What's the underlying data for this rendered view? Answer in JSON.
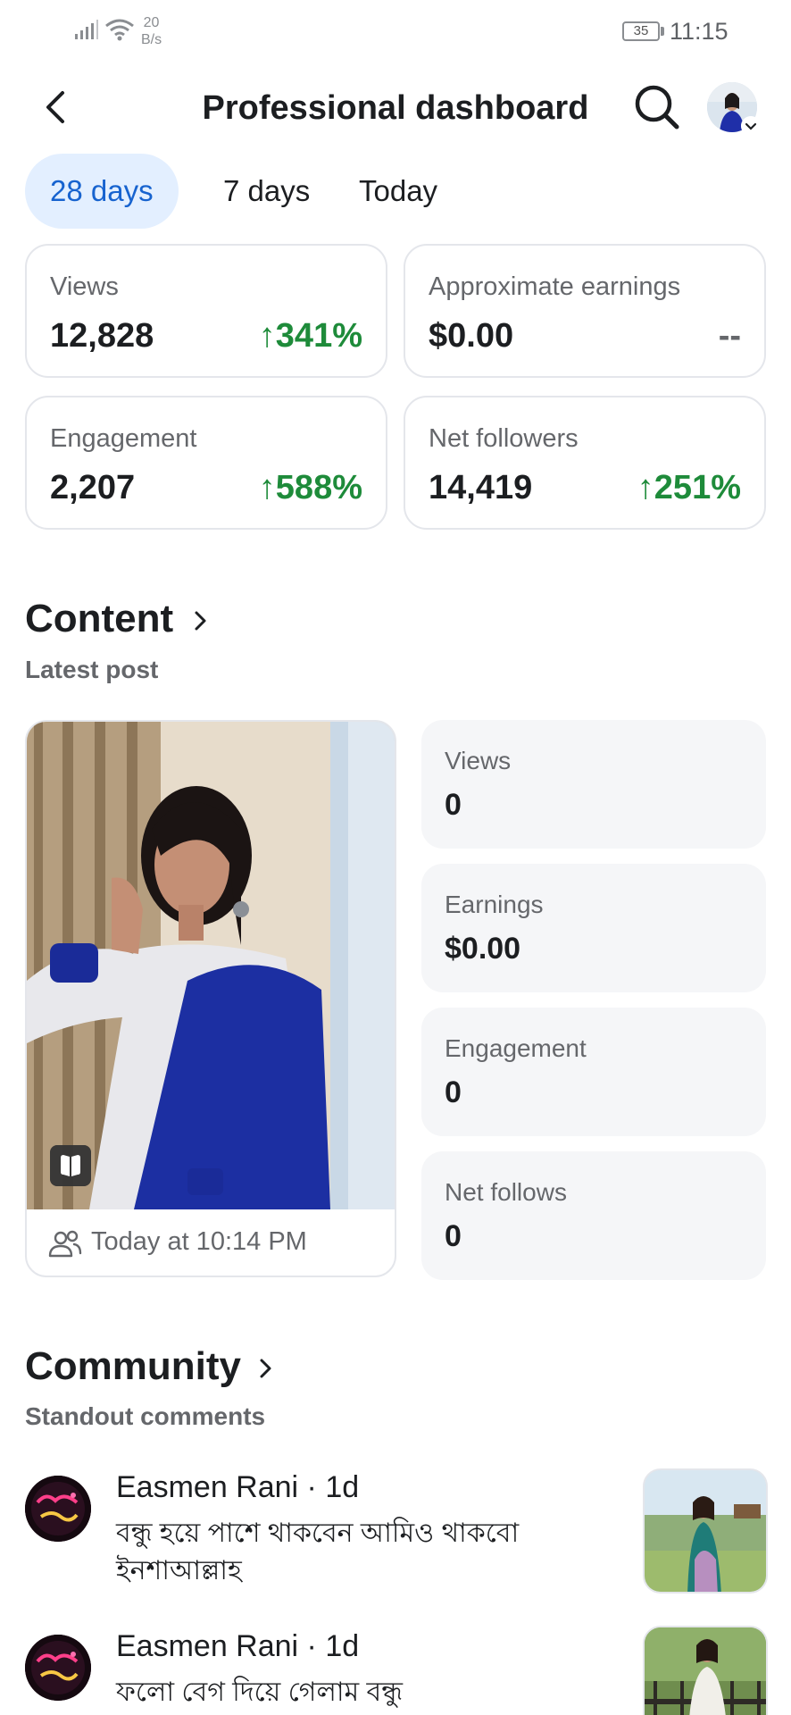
{
  "status_bar": {
    "net_speed_value": "20",
    "net_speed_unit": "B/s",
    "battery": "35",
    "time": "11:15"
  },
  "header": {
    "title": "Professional dashboard",
    "back_icon": "chevron-left-icon",
    "search_icon": "search-icon"
  },
  "filters": {
    "chips": [
      "28 days",
      "7 days",
      "Today"
    ],
    "selected": "28 days"
  },
  "metrics": [
    {
      "label": "Views",
      "value": "12,828",
      "delta": "↑341%"
    },
    {
      "label": "Approximate earnings",
      "value": "$0.00",
      "delta": "--"
    },
    {
      "label": "Engagement",
      "value": "2,207",
      "delta": "↑588%"
    },
    {
      "label": "Net followers",
      "value": "14,419",
      "delta": "↑251%"
    }
  ],
  "colors": {
    "accent": "#1763cf",
    "chip_active_bg": "#e3efff",
    "positive": "#1e8b3a",
    "muted_text": "#65676b",
    "card_border": "#e4e6eb",
    "stat_bg": "#f5f6f8"
  },
  "content": {
    "title": "Content",
    "subtitle": "Latest post",
    "post": {
      "time": "Today at 10:14 PM",
      "audience_icon": "people-icon",
      "type_icon": "reel-icon"
    },
    "stats": [
      {
        "label": "Views",
        "value": "0"
      },
      {
        "label": "Earnings",
        "value": "$0.00"
      },
      {
        "label": "Engagement",
        "value": "0"
      },
      {
        "label": "Net follows",
        "value": "0"
      }
    ]
  },
  "community": {
    "title": "Community",
    "subtitle": "Standout comments",
    "comments": [
      {
        "name": "Easmen Rani",
        "time": " · 1d",
        "text": "বন্ধু হয়ে পাশে থাকবেন আমিও থাকবো ইনশাআল্লাহ"
      },
      {
        "name": "Easmen Rani",
        "time": " · 1d",
        "text": "ফলো বেগ দিয়ে গেলাম বন্ধু"
      }
    ]
  }
}
